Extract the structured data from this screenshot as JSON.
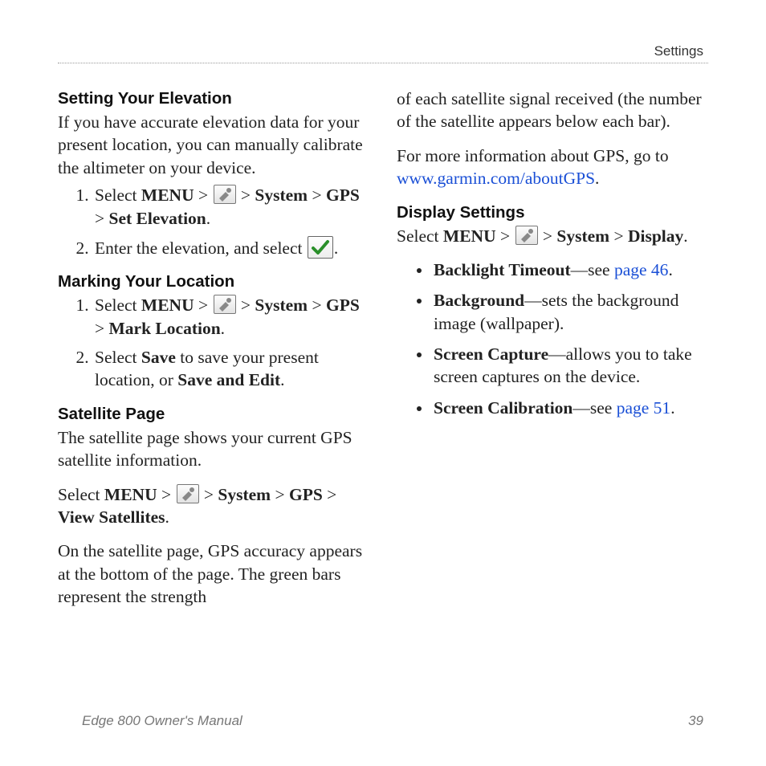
{
  "header": {
    "section": "Settings"
  },
  "footer": {
    "title": "Edge 800 Owner's Manual",
    "page": "39"
  },
  "left": {
    "s1": {
      "title": "Setting Your Elevation",
      "intro": "If you have accurate elevation data for your present location, you can manually calibrate the altimeter on your device.",
      "step1_a": "Select ",
      "step1_menu": "MENU",
      "step1_gt1": " > ",
      "step1_gt2": " > ",
      "step1_system": "System",
      "step1_gt3": " > ",
      "step1_gps": "GPS",
      "step1_gt4": " > ",
      "step1_end": "Set Elevation",
      "step1_dot": ".",
      "step2_a": "Enter the elevation, and select ",
      "step2_dot": "."
    },
    "s2": {
      "title": "Marking Your Location",
      "step1_a": "Select ",
      "step1_menu": "MENU",
      "step1_gt1": " > ",
      "step1_gt2": " > ",
      "step1_system": "System",
      "step1_gt3": " > ",
      "step1_gps": "GPS",
      "step1_gt4": " > ",
      "step1_end": "Mark Location",
      "step1_dot": ".",
      "step2_a": "Select ",
      "step2_save": "Save",
      "step2_b": " to save your present location, or ",
      "step2_saveedit": "Save and Edit",
      "step2_dot": "."
    },
    "s3": {
      "title": "Satellite Page",
      "intro": "The satellite page shows your current GPS satellite information.",
      "p_a": "Select ",
      "p_menu": "MENU",
      "p_gt1": " > ",
      "p_gt2": " > ",
      "p_system": "System",
      "p_gt3": " > ",
      "p_gps": "GPS",
      "p_gt4": " > ",
      "p_end": "View Satellites",
      "p_dot": ".",
      "tail": "On the satellite page, GPS accuracy appears at the bottom of the page. The green bars represent the strength"
    }
  },
  "right": {
    "cont1": "of each satellite signal received (the number of the satellite appears below each bar).",
    "info_a": "For more information about GPS, go to ",
    "info_link": "www.garmin.com/aboutGPS",
    "info_dot": ".",
    "disp": {
      "title": "Display Settings",
      "p_a": "Select ",
      "p_menu": "MENU",
      "p_gt1": " > ",
      "p_gt2": " > ",
      "p_system": "System",
      "p_gt3": " > ",
      "p_display": "Display",
      "p_dot": "."
    },
    "items": {
      "b1_bold": "Backlight Timeout",
      "b1_a": "—see ",
      "b1_link": "page 46",
      "b1_dot": ".",
      "b2_bold": "Background",
      "b2_a": "—sets the background image (wallpaper).",
      "b3_bold": "Screen Capture",
      "b3_a": "—allows you to take screen captures on the device.",
      "b4_bold": "Screen Calibration",
      "b4_a": "—see ",
      "b4_link": "page 51",
      "b4_dot": "."
    }
  }
}
